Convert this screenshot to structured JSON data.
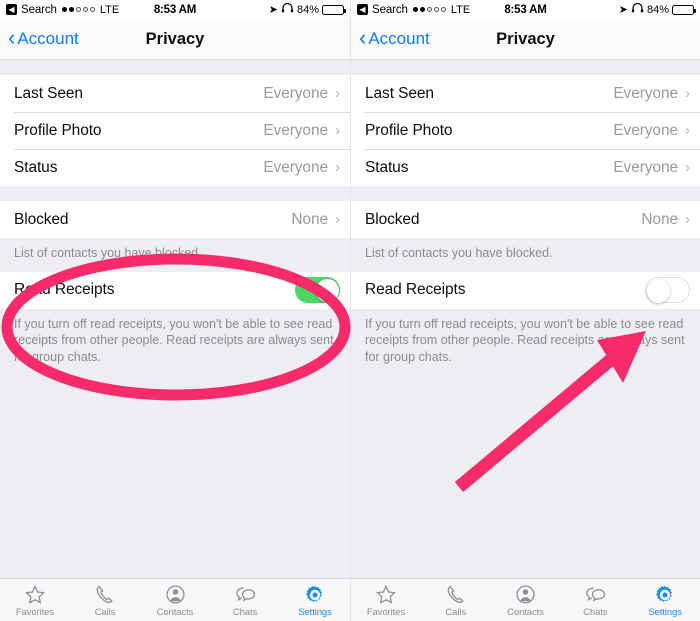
{
  "app": {
    "screen_title": "Privacy",
    "back_label": "Account"
  },
  "status_bar": {
    "carrier_back_icon": "back-arrow-icon",
    "carrier": "Search",
    "signal_dots_filled": 2,
    "signal_dots_total": 5,
    "network": "LTE",
    "time": "8:53 AM",
    "location_icon": "location-arrow-icon",
    "headphones_icon": "headphones-icon",
    "battery_percent": "84%",
    "battery_level": 84
  },
  "sections": [
    {
      "name": "visibility",
      "rows": [
        {
          "label": "Last Seen",
          "value": "Everyone",
          "accessory": "chevron-right-icon"
        },
        {
          "label": "Profile Photo",
          "value": "Everyone",
          "accessory": "chevron-right-icon"
        },
        {
          "label": "Status",
          "value": "Everyone",
          "accessory": "chevron-right-icon"
        }
      ],
      "footnote": ""
    },
    {
      "name": "blocked",
      "rows": [
        {
          "label": "Blocked",
          "value": "None",
          "accessory": "chevron-right-icon"
        }
      ],
      "footnote": "List of contacts you have blocked."
    },
    {
      "name": "read-receipts",
      "rows": [
        {
          "label": "Read Receipts",
          "value": "",
          "accessory": "toggle-switch"
        }
      ],
      "footnote": "If you turn off read receipts, you won't be able to see read receipts from other people. Read receipts are always sent for group chats."
    }
  ],
  "panels": [
    {
      "id": "before",
      "read_receipts_on": true,
      "read_receipts_state_label": "On",
      "annotation": "highlight-ellipse"
    },
    {
      "id": "after",
      "read_receipts_on": false,
      "read_receipts_state_label": "Off",
      "annotation": "pointer-arrow"
    }
  ],
  "tab_bar": {
    "tabs": [
      {
        "label": "Favorites",
        "icon": "star-icon",
        "active": false
      },
      {
        "label": "Calls",
        "icon": "phone-icon",
        "active": false
      },
      {
        "label": "Contacts",
        "icon": "person-circle-icon",
        "active": false
      },
      {
        "label": "Chats",
        "icon": "speech-bubbles-icon",
        "active": false
      },
      {
        "label": "Settings",
        "icon": "gear-icon",
        "active": true
      }
    ]
  },
  "colors": {
    "accent_blue": "#0a7cff",
    "toggle_on_green": "#4cd763",
    "annotation_pink": "#f72b6b",
    "tab_inactive_gray": "#8e8e93",
    "group_background": "#eeeef2"
  }
}
